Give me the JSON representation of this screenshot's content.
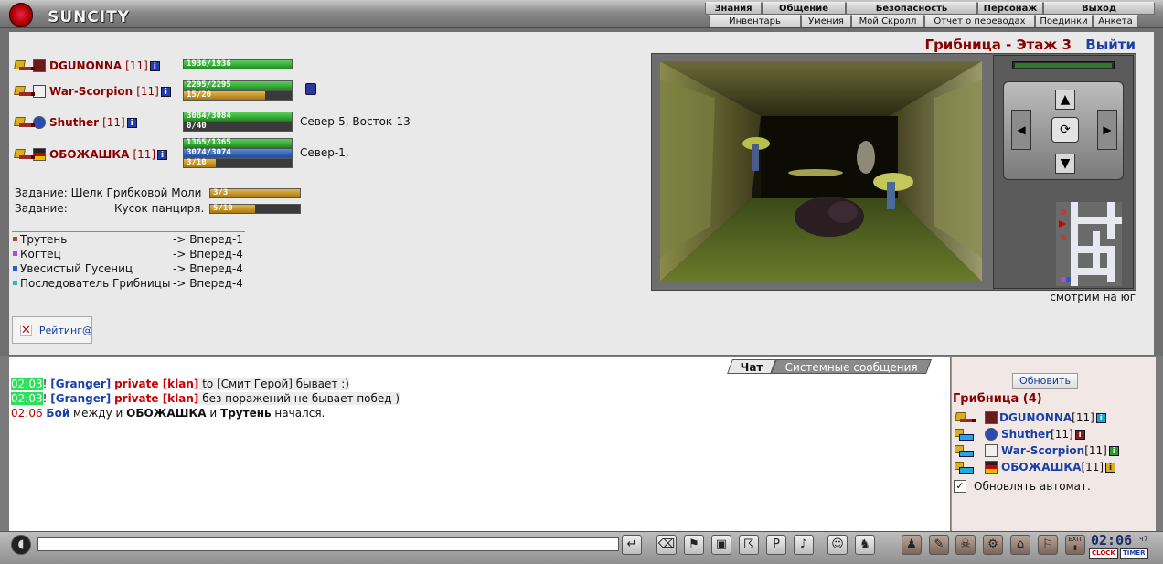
{
  "app": {
    "logo_text": "SUNCITY"
  },
  "menu": {
    "top": [
      "Знания",
      "Общение",
      "Безопасность",
      "Персонаж",
      "Выход"
    ],
    "sub": [
      "Инвентарь",
      "Умения",
      "Мой Скролл",
      "Отчет о переводах",
      "Поединки",
      "Анкета"
    ]
  },
  "location": {
    "title": "Грибница - Этаж 3",
    "exit_label": "Выйти",
    "look_direction": "смотрим на юг"
  },
  "party": [
    {
      "name": "DGUNONNA",
      "level": "[11]",
      "hp": "1936/1936",
      "hp_frac": 1.0
    },
    {
      "name": "War-Scorpion",
      "level": "[11]",
      "hp": "2295/2295",
      "hp_frac": 1.0,
      "sp": "15/20",
      "sp_frac": 0.75
    },
    {
      "name": "Shuther",
      "level": "[11]",
      "hp": "3084/3084",
      "hp_frac": 1.0,
      "sp": "0/40",
      "sp_frac": 0.0,
      "coords": "Север-5, Восток-13"
    },
    {
      "name": "ОБОЖАШКА",
      "level": "[11]",
      "hp": "1365/1365",
      "hp_frac": 1.0,
      "mp": "3074/3074",
      "mp_frac": 1.0,
      "sp": "3/10",
      "sp_frac": 0.3,
      "coords": "Север-1,"
    }
  ],
  "quests": [
    {
      "label": "Задание: Шелк Грибковой Моли",
      "progress": "3/3",
      "frac": 1.0
    },
    {
      "label": "Задание:",
      "item": "Кусок панциря.",
      "progress": "5/10",
      "frac": 0.5
    }
  ],
  "mobs": [
    {
      "name": "Трутень",
      "dir": "-> Вперед-1",
      "color": "#c23a3a"
    },
    {
      "name": "Когтец",
      "dir": "-> Вперед-4",
      "color": "#b04ad0"
    },
    {
      "name": "Увесистый Гусениц",
      "dir": "-> Вперед-4",
      "color": "#2a5ad0"
    },
    {
      "name": "Последователь Грибницы",
      "dir": "-> Вперед-4",
      "color": "#2ab6c6"
    }
  ],
  "rating": {
    "label": "Рейтинг@"
  },
  "chat": {
    "tabs": {
      "chat": "Чат",
      "system": "Системные сообщения"
    },
    "lines": [
      {
        "time": "02:03",
        "bang": "!",
        "sender": "[Granger]",
        "kind": "private [klan]",
        "rest": " to [Смит Герой] бывает :)"
      },
      {
        "time": "02:03",
        "bang": "!",
        "sender": "[Granger]",
        "kind": "private [klan]",
        "rest": " без поражений не бывает побед )"
      },
      {
        "time": "02:06",
        "p1": "Бой",
        "p2": " между и ",
        "p3": "ОБОЖАШКА",
        "p4": " и ",
        "p5": "Трутень",
        "p6": " начался."
      }
    ]
  },
  "side": {
    "refresh_label": "Обновить",
    "location_count": "Грибница (4)",
    "players": [
      {
        "name": "DGUNONNA",
        "level": "[11]"
      },
      {
        "name": "Shuther",
        "level": "[11]"
      },
      {
        "name": "War-Scorpion",
        "level": "[11]"
      },
      {
        "name": "ОБОЖАШКА",
        "level": "[11]"
      }
    ],
    "auto_update_label": "Обновлять автомат."
  },
  "clock": {
    "time": "02:06",
    "suffix": "ч7",
    "clock_label": "CLOCK",
    "timer_label": "TIMER"
  },
  "toolbar": {
    "exit_text": "EXIT"
  }
}
